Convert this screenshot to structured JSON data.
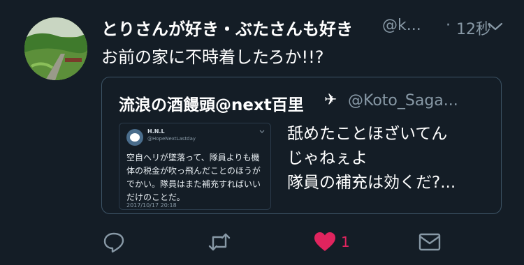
{
  "tweet": {
    "display_name": "とりさんが好き・ぶたさんも好き",
    "handle": "@k...",
    "separator": "·",
    "time": "12秒",
    "text": "お前の家に不時着したろか!!?",
    "like_count": "1"
  },
  "quote": {
    "display_name": "流浪の酒饅頭@next百里",
    "plane_glyph": "✈",
    "handle": "@Koto_Saga...",
    "text_lines": [
      "舐めたことほざいてん",
      "じゃねぇよ",
      "隊員の補充は効くだ?..."
    ],
    "embed": {
      "name": "H.N.L",
      "handle": "@HopeNextLastday",
      "text_lines": [
        "空自ヘリが墜落って、隊員よりも機",
        "体の税金が吹っ飛んだことのほうが",
        "でかい。隊員はまた補充すればいい",
        "だけのことだ。"
      ],
      "date": "2017/10/17 20:18"
    }
  },
  "colors": {
    "background": "#141d26",
    "secondary_text": "#8899a6",
    "like": "#e0245e",
    "icon": "#8899a6",
    "border": "#3d5466"
  },
  "icons": [
    "chevron-down-icon",
    "reply-icon",
    "retweet-icon",
    "heart-icon",
    "mail-icon"
  ]
}
